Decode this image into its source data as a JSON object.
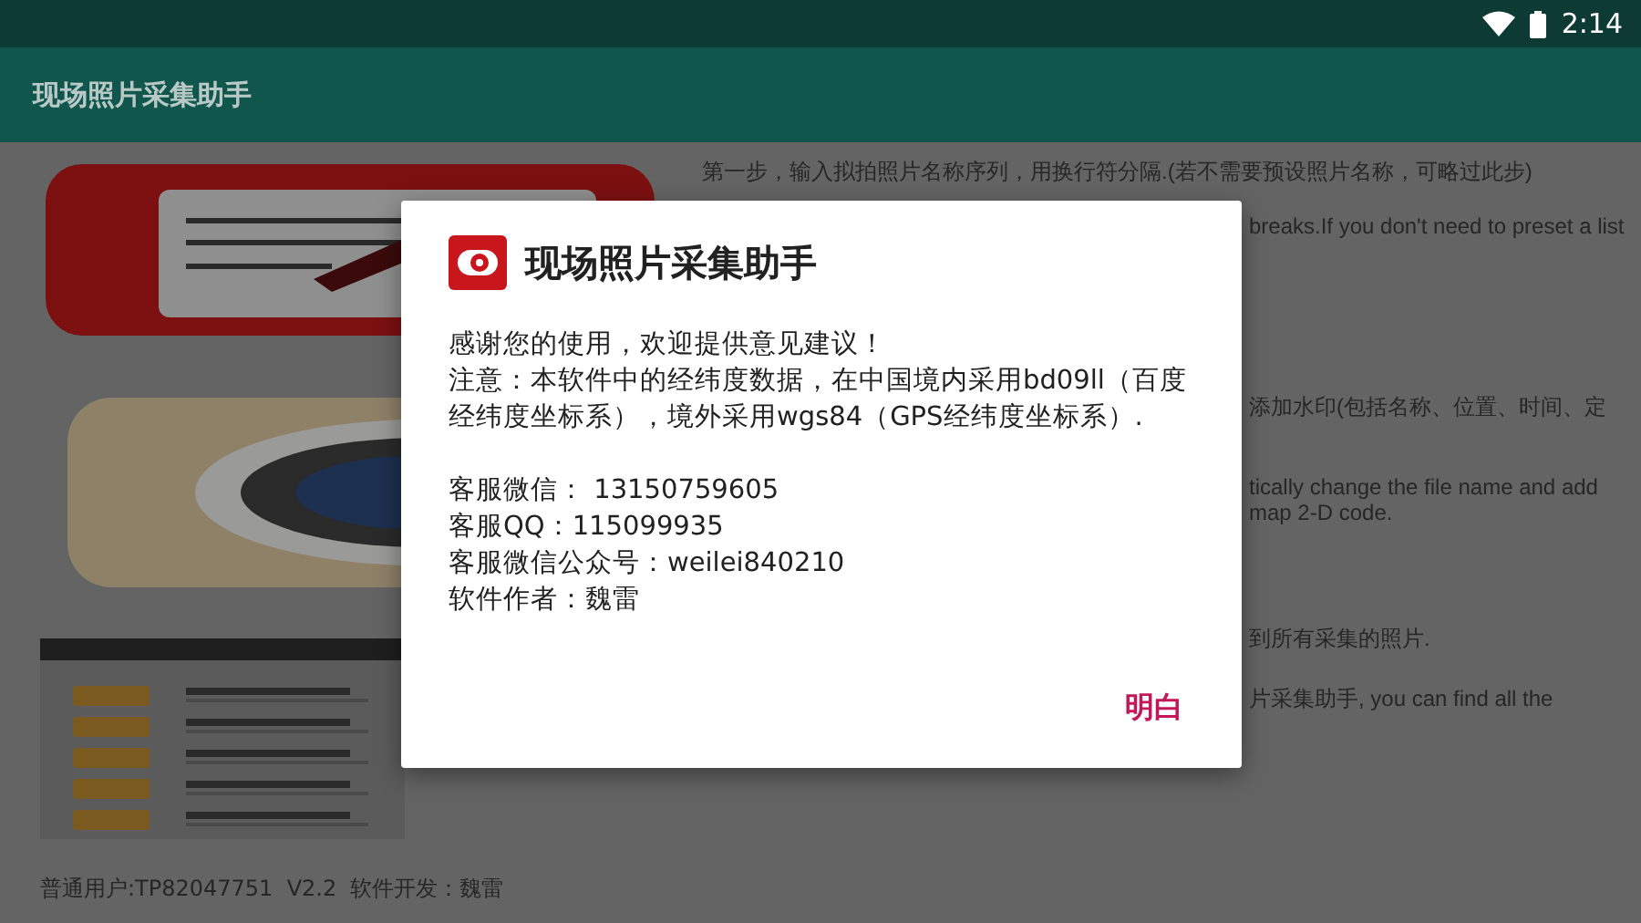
{
  "status_bar": {
    "time": "2:14"
  },
  "app_bar": {
    "title": "现场照片采集助手"
  },
  "instructions": [
    {
      "text": "第一步，输入拟拍照片名称序列，用换行符分隔.(若不需要预设照片名称，可略过此步)",
      "kind": "full"
    },
    {
      "text": "breaks.If you don't need to preset a list",
      "kind": "partial"
    },
    {
      "text": "添加水印(包括名称、位置、时间、定",
      "kind": "partial"
    },
    {
      "text": "tically change the file name and add",
      "kind": "partial"
    },
    {
      "text": "map 2-D code.",
      "kind": "partial"
    },
    {
      "text": "到所有采集的照片.",
      "kind": "partial"
    },
    {
      "text": "片采集助手, you can find all the",
      "kind": "partial"
    }
  ],
  "footer": "普通用户:TP82047751  V2.2  软件开发：魏雷",
  "dialog": {
    "title": "现场照片采集助手",
    "paragraphs": [
      [
        "感谢您的使用，欢迎提供意见建议！",
        "注意：本软件中的经纬度数据，在中国境内采用bd09ll（百度经纬度坐标系），境外采用wgs84（GPS经纬度坐标系）."
      ],
      [
        "客服微信： 13150759605",
        "客服QQ：115099935",
        "客服微信公众号：weilei840210",
        "软件作者：魏雷"
      ]
    ],
    "button": "明白"
  }
}
